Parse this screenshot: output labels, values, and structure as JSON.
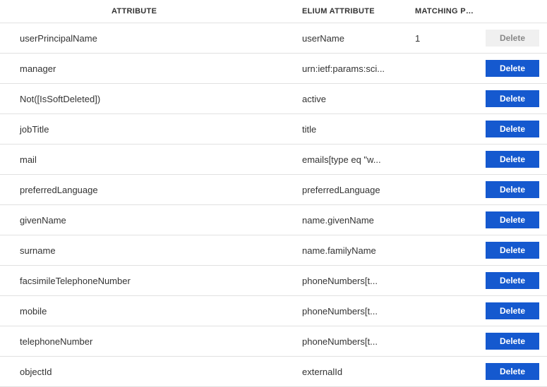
{
  "headers": {
    "attribute": "ATTRIBUTE",
    "elium": "ELIUM ATTRIBUTE",
    "matching": "MATCHING PREC..."
  },
  "delete_label": "Delete",
  "rows": [
    {
      "attribute": "userPrincipalName",
      "elium": "userName",
      "matching": "1",
      "enabled": false
    },
    {
      "attribute": "manager",
      "elium": "urn:ietf:params:sci...",
      "matching": "",
      "enabled": true
    },
    {
      "attribute": "Not([IsSoftDeleted])",
      "elium": "active",
      "matching": "",
      "enabled": true
    },
    {
      "attribute": "jobTitle",
      "elium": "title",
      "matching": "",
      "enabled": true
    },
    {
      "attribute": "mail",
      "elium": "emails[type eq \"w...",
      "matching": "",
      "enabled": true
    },
    {
      "attribute": "preferredLanguage",
      "elium": "preferredLanguage",
      "matching": "",
      "enabled": true
    },
    {
      "attribute": "givenName",
      "elium": "name.givenName",
      "matching": "",
      "enabled": true
    },
    {
      "attribute": "surname",
      "elium": "name.familyName",
      "matching": "",
      "enabled": true
    },
    {
      "attribute": "facsimileTelephoneNumber",
      "elium": "phoneNumbers[t...",
      "matching": "",
      "enabled": true
    },
    {
      "attribute": "mobile",
      "elium": "phoneNumbers[t...",
      "matching": "",
      "enabled": true
    },
    {
      "attribute": "telephoneNumber",
      "elium": "phoneNumbers[t...",
      "matching": "",
      "enabled": true
    },
    {
      "attribute": "objectId",
      "elium": "externalId",
      "matching": "",
      "enabled": true
    }
  ]
}
